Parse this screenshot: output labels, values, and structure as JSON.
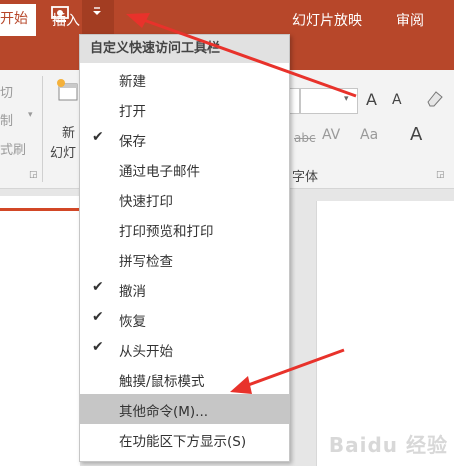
{
  "qat": {
    "undo_icon": "undo-icon",
    "presenter_icon": "presenter-icon",
    "dropdown_icon": "dropdown-arrow-icon"
  },
  "tabs": [
    {
      "label": "开始",
      "active": true
    },
    {
      "label": "插入"
    },
    {
      "label": "幻灯片放映"
    },
    {
      "label": "审阅"
    }
  ],
  "ribbon": {
    "cut": "切",
    "copy": "制",
    "format_painter": "式刷",
    "new_slide_1": "新",
    "new_slide_2": "幻灯",
    "font_group_label": "字体",
    "grow_font": "A",
    "shrink_font": "A",
    "strikethrough": "abc",
    "char_spacing": "AV",
    "change_case": "Aa",
    "font_color": "A"
  },
  "menu": {
    "header": "自定义快速访问工具栏",
    "items": [
      {
        "label": "新建",
        "checked": false
      },
      {
        "label": "打开",
        "checked": false
      },
      {
        "label": "保存",
        "checked": true
      },
      {
        "label": "通过电子邮件",
        "checked": false
      },
      {
        "label": "快速打印",
        "checked": false
      },
      {
        "label": "打印预览和打印",
        "checked": false
      },
      {
        "label": "拼写检查",
        "checked": false
      },
      {
        "label": "撤消",
        "checked": true
      },
      {
        "label": "恢复",
        "checked": true
      },
      {
        "label": "从头开始",
        "checked": true
      },
      {
        "label": "触摸/鼠标模式",
        "checked": false
      },
      {
        "label": "其他命令(M)...",
        "checked": false,
        "highlighted": true
      },
      {
        "label": "在功能区下方显示(S)",
        "checked": false
      }
    ]
  },
  "check_glyph": "✔",
  "watermark": "Baidu 经验",
  "annotation_color": "#e8322b"
}
